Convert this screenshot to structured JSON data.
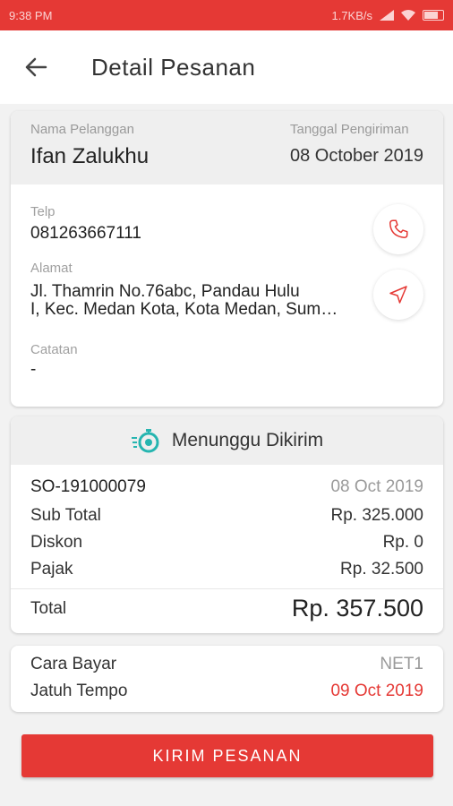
{
  "status_bar": {
    "time": "9:38 PM",
    "network_speed": "1.7KB/s"
  },
  "header": {
    "title": "Detail Pesanan"
  },
  "customer": {
    "name_label": "Nama Pelanggan",
    "name": "Ifan Zalukhu",
    "date_label": "Tanggal Pengiriman",
    "date": "08 October 2019",
    "phone_label": "Telp",
    "phone": "081263667111",
    "address_label": "Alamat",
    "address_line1": "Jl. Thamrin No.76abc, Pandau Hulu",
    "address_line2": "I, Kec. Medan Kota, Kota Medan, Sum…",
    "note_label": "Catatan",
    "note": "-"
  },
  "order": {
    "status": "Menunggu Dikirim",
    "so_number": "SO-191000079",
    "so_date": "08 Oct 2019",
    "subtotal_label": "Sub Total",
    "subtotal": "Rp. 325.000",
    "discount_label": "Diskon",
    "discount": "Rp. 0",
    "tax_label": "Pajak",
    "tax": "Rp. 32.500",
    "total_label": "Total",
    "total": "Rp. 357.500"
  },
  "payment": {
    "method_label": "Cara Bayar",
    "method": "NET1",
    "due_label": "Jatuh Tempo",
    "due_date": "09 Oct 2019"
  },
  "action": {
    "label": "KIRIM PESANAN"
  },
  "colors": {
    "accent": "#e53935",
    "status_icon": "#26b5b0"
  },
  "icons": [
    "back-arrow-icon",
    "phone-icon",
    "navigation-icon",
    "stopwatch-icon"
  ]
}
